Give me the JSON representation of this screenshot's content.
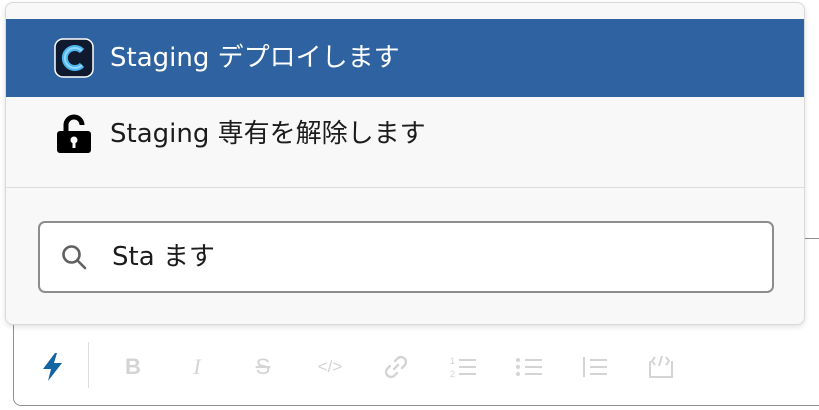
{
  "popup": {
    "items": [
      {
        "label": "Staging デプロイします",
        "icon": "app-c-icon",
        "selected": true
      },
      {
        "label": "Staging 専有を解除します",
        "icon": "unlock-icon",
        "selected": false
      }
    ],
    "search": {
      "value": "Sta ます",
      "icon": "search-icon"
    }
  },
  "toolbar": {
    "buttons": [
      {
        "name": "shortcuts",
        "icon": "lightning-icon"
      },
      {
        "name": "bold",
        "glyph": "B",
        "icon": "bold-icon"
      },
      {
        "name": "italic",
        "glyph": "I",
        "icon": "italic-icon"
      },
      {
        "name": "strikethrough",
        "glyph": "S",
        "icon": "strikethrough-icon"
      },
      {
        "name": "code",
        "glyph": "</>",
        "icon": "code-icon"
      },
      {
        "name": "link",
        "icon": "link-icon"
      },
      {
        "name": "ordered-list",
        "icon": "ordered-list-icon"
      },
      {
        "name": "bulleted-list",
        "icon": "bulleted-list-icon"
      },
      {
        "name": "blockquote",
        "icon": "blockquote-icon"
      },
      {
        "name": "code-block",
        "icon": "code-block-icon"
      }
    ]
  },
  "colors": {
    "selected_bg": "#2e62a0",
    "accent": "#1264a3",
    "disabled": "#d4d4d4"
  }
}
